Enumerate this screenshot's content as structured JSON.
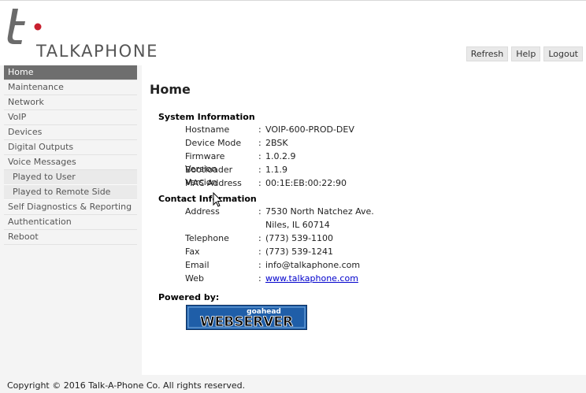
{
  "brand": {
    "name": "TALKAPHONE"
  },
  "header": {
    "buttons": {
      "refresh": "Refresh",
      "help": "Help",
      "logout": "Logout"
    }
  },
  "sidebar": {
    "items": [
      "Home",
      "Maintenance",
      "Network",
      "VoIP",
      "Devices",
      "Digital Outputs",
      "Voice Messages",
      "Played to User",
      "Played to Remote Side",
      "Self Diagnostics & Reporting",
      "Authentication",
      "Reboot"
    ]
  },
  "main": {
    "title": "Home",
    "system": {
      "heading": "System Information",
      "hostname_label": "Hostname",
      "hostname": "VOIP-600-PROD-DEV",
      "mode_label": "Device Mode",
      "mode": "2BSK",
      "fw_label": "Firmware Version",
      "fw": "1.0.2.9",
      "bl_label": "Bootloader Version",
      "bl": "1.1.9",
      "mac_label": "MAC Address",
      "mac": "00:1E:EB:00:22:90"
    },
    "contact": {
      "heading": "Contact Information",
      "address_label": "Address",
      "address1": "7530 North Natchez Ave.",
      "address2": "Niles, IL 60714",
      "tel_label": "Telephone",
      "tel": "(773) 539-1100",
      "fax_label": "Fax",
      "fax": "(773) 539-1241",
      "email_label": "Email",
      "email": "info@talkaphone.com",
      "web_label": "Web",
      "web": "www.talkaphone.com"
    },
    "powered": {
      "heading": "Powered by:",
      "badge_top": "goahead",
      "badge_main": "WEBSERVER"
    }
  },
  "footer": {
    "copyright": "Copyright © 2016 Talk-A-Phone Co. All rights reserved."
  }
}
